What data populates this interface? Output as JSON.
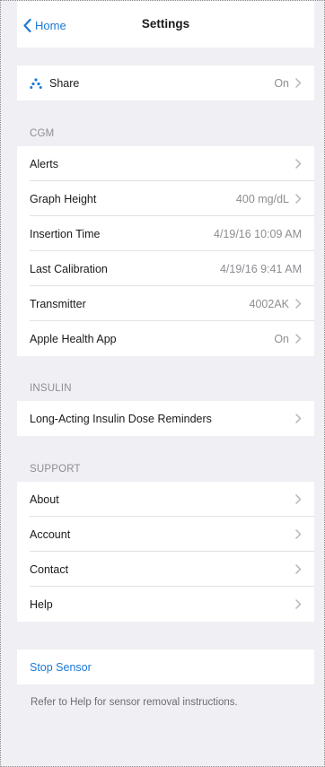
{
  "nav": {
    "back_label": "Home",
    "title": "Settings"
  },
  "share_row": {
    "label": "Share",
    "value": "On"
  },
  "sections": {
    "cgm": {
      "header": "CGM",
      "rows": [
        {
          "label": "Alerts",
          "value": "",
          "chevron": true
        },
        {
          "label": "Graph Height",
          "value": "400 mg/dL",
          "chevron": true
        },
        {
          "label": "Insertion Time",
          "value": "4/19/16 10:09 AM",
          "chevron": false
        },
        {
          "label": "Last Calibration",
          "value": "4/19/16 9:41 AM",
          "chevron": false
        },
        {
          "label": "Transmitter",
          "value": "4002AK",
          "chevron": true
        },
        {
          "label": "Apple Health App",
          "value": "On",
          "chevron": true
        }
      ]
    },
    "insulin": {
      "header": "INSULIN",
      "rows": [
        {
          "label": "Long-Acting Insulin Dose Reminders",
          "value": "",
          "chevron": true
        }
      ]
    },
    "support": {
      "header": "SUPPORT",
      "rows": [
        {
          "label": "About",
          "value": "",
          "chevron": true
        },
        {
          "label": "Account",
          "value": "",
          "chevron": true
        },
        {
          "label": "Contact",
          "value": "",
          "chevron": true
        },
        {
          "label": "Help",
          "value": "",
          "chevron": true
        }
      ]
    }
  },
  "stop_sensor": {
    "label": "Stop Sensor",
    "footnote": "Refer to Help for sensor removal instructions."
  },
  "colors": {
    "accent": "#1b79d8",
    "background": "#efeff4",
    "secondary_text": "#8e8e93"
  },
  "icons": {
    "back": "chevron-left-icon",
    "share": "share-dots-icon",
    "disclosure": "chevron-right-icon"
  }
}
